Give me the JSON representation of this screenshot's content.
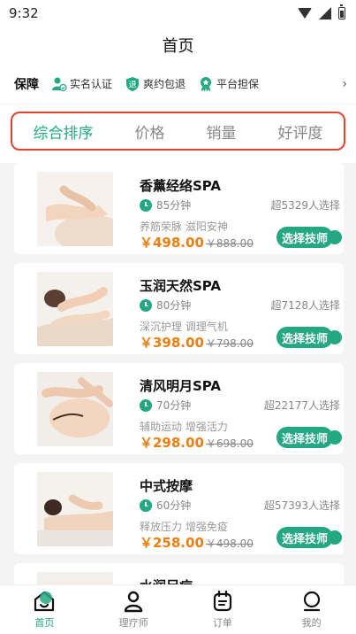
{
  "status_bar": {
    "time": "9:32"
  },
  "header": {
    "title": "首页"
  },
  "guarantee": {
    "title": "保障",
    "items": [
      {
        "label": "实名认证",
        "icon": "verified-user-icon"
      },
      {
        "label": "爽约包退",
        "icon": "refund-icon"
      },
      {
        "label": "平台担保",
        "icon": "badge-icon"
      }
    ],
    "more_icon": "chevron-right-icon",
    "more_glyph": "›"
  },
  "sort_tabs": [
    {
      "label": "综合排序",
      "active": true
    },
    {
      "label": "价格",
      "active": false
    },
    {
      "label": "销量",
      "active": false
    },
    {
      "label": "好评度",
      "active": false
    }
  ],
  "services": [
    {
      "title": "香薰经络SPA",
      "duration": "85分钟",
      "sold": "超5329人选择",
      "desc": "养筋荣脉 滋阳安神",
      "price": "￥498.00",
      "price_old": "￥888.00",
      "button": "选择技师"
    },
    {
      "title": "玉润天然SPA",
      "duration": "80分钟",
      "sold": "超7128人选择",
      "desc": "深沉护理 调理气机",
      "price": "￥398.00",
      "price_old": "￥798.00",
      "button": "选择技师"
    },
    {
      "title": "清风明月SPA",
      "duration": "70分钟",
      "sold": "超22177人选择",
      "desc": "辅助运动 增强活力",
      "price": "￥298.00",
      "price_old": "￥698.00",
      "button": "选择技师"
    },
    {
      "title": "中式按摩",
      "duration": "60分钟",
      "sold": "超57393人选择",
      "desc": "释放压力 增强免疫",
      "price": "￥258.00",
      "price_old": "￥498.00",
      "button": "选择技师"
    },
    {
      "title": "水润足疗"
    }
  ],
  "tabbar": [
    {
      "label": "首页",
      "icon": "home-icon",
      "active": true
    },
    {
      "label": "理疗师",
      "icon": "person-icon",
      "active": false
    },
    {
      "label": "订单",
      "icon": "calendar-icon",
      "active": false
    },
    {
      "label": "我的",
      "icon": "profile-icon",
      "active": false
    }
  ],
  "colors": {
    "accent": "#23a883",
    "price": "#f07d0f",
    "highlight_border": "#e0452f"
  }
}
